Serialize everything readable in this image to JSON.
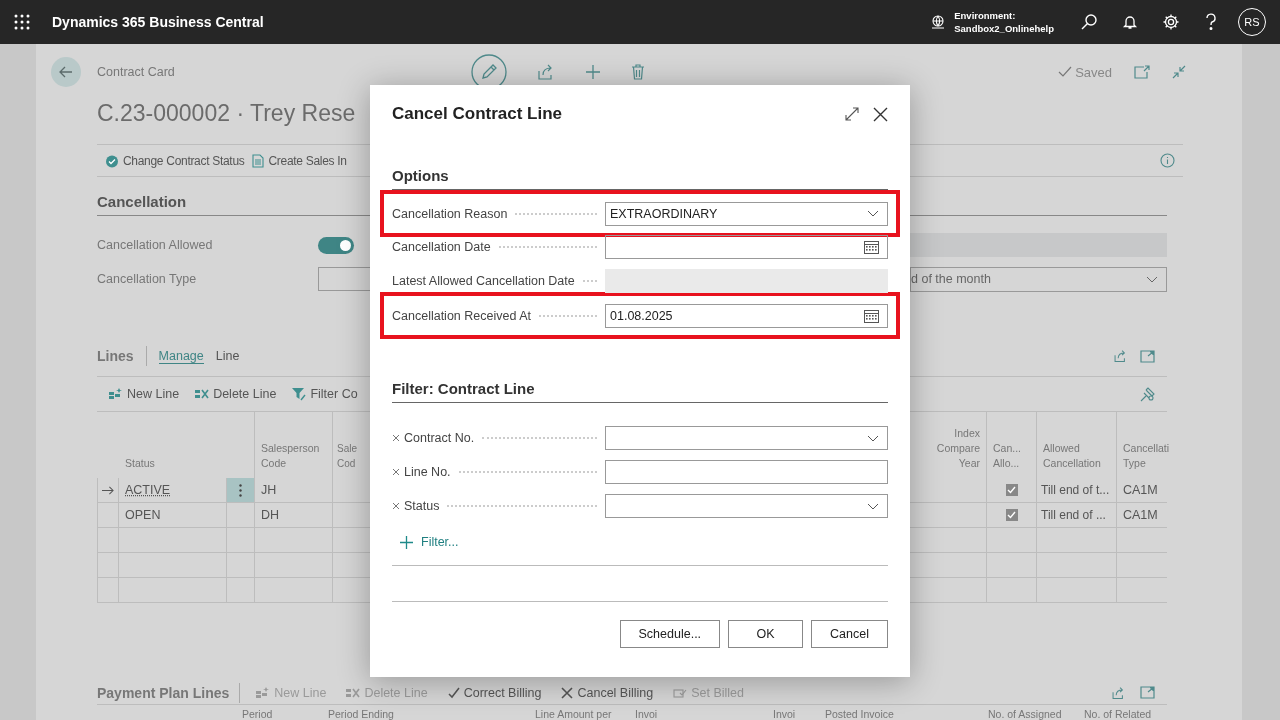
{
  "app_bar": {
    "product": "Dynamics 365 Business Central",
    "environment_label": "Environment:",
    "environment_name": "Sandbox2_Onlinehelp",
    "user_initials": "RS"
  },
  "page": {
    "breadcrumb": "Contract Card",
    "title": "C.23-000002 · Trey Rese",
    "status": "Saved",
    "actions": [
      {
        "kind": "status",
        "label": "Change Contract Status"
      },
      {
        "kind": "document",
        "label": "Create Sales In"
      }
    ]
  },
  "cancellation": {
    "heading": "Cancellation",
    "allowed_label": "Cancellation Allowed",
    "allowed_on": true,
    "type_label": "Cancellation Type",
    "right_dropdown_value": "d of the month"
  },
  "lines": {
    "heading": "Lines",
    "tabs": [
      {
        "label": "Manage",
        "selected": true
      },
      {
        "label": "Line",
        "selected": false
      }
    ],
    "actions": [
      {
        "kind": "new",
        "label": "New Line"
      },
      {
        "kind": "delete",
        "label": "Delete Line"
      },
      {
        "kind": "filter",
        "label": "Filter Co"
      }
    ],
    "columns": [
      "Status",
      "Salesperson Code",
      "Sale Cod",
      "Index Compare Year",
      "Can... Allo...",
      "Allowed Cancellation",
      "Cancellati Type"
    ],
    "rows": [
      {
        "selected": true,
        "status": "ACTIVE",
        "salesperson_code": "JH",
        "cancellation_allowed": true,
        "allowed_cancellation": "Till end of t...",
        "cancellation_type": "CA1M"
      },
      {
        "selected": false,
        "status": "OPEN",
        "salesperson_code": "DH",
        "cancellation_allowed": true,
        "allowed_cancellation": "Till end of ...",
        "cancellation_type": "CA1M"
      }
    ]
  },
  "payment_plan": {
    "heading": "Payment Plan Lines",
    "actions": [
      {
        "kind": "new",
        "label": "New Line",
        "disabled": true
      },
      {
        "kind": "delete",
        "label": "Delete Line",
        "disabled": true
      },
      {
        "kind": "correct",
        "label": "Correct Billing",
        "disabled": false
      },
      {
        "kind": "cancel",
        "label": "Cancel Billing",
        "disabled": false
      },
      {
        "kind": "billed",
        "label": "Set Billed",
        "disabled": true
      }
    ],
    "columns": [
      "Period",
      "Period Ending",
      "Line Amount per",
      "Invoi",
      "Invoi",
      "Posted Invoice",
      "No. of Assigned",
      "No. of Related"
    ]
  },
  "dialog": {
    "title": "Cancel Contract Line",
    "options_heading": "Options",
    "options": [
      {
        "kind": "dropdown",
        "label": "Cancellation Reason",
        "value": "EXTRAORDINARY",
        "highlighted": true
      },
      {
        "kind": "date",
        "label": "Cancellation Date",
        "highlighted": false
      },
      {
        "kind": "readonly",
        "label": "Latest Allowed Cancellation Date",
        "highlighted": false
      },
      {
        "kind": "date",
        "label": "Cancellation Received At",
        "value": "01.08.2025",
        "highlighted": true
      }
    ],
    "filter_heading": "Filter: Contract Line",
    "filters": [
      {
        "kind": "dropdown",
        "label": "Contract No."
      },
      {
        "kind": "text",
        "label": "Line No."
      },
      {
        "kind": "dropdown",
        "label": "Status"
      }
    ],
    "add_filter": "Filter...",
    "buttons": [
      {
        "label": "Schedule..."
      },
      {
        "label": "OK"
      },
      {
        "label": "Cancel"
      }
    ]
  }
}
